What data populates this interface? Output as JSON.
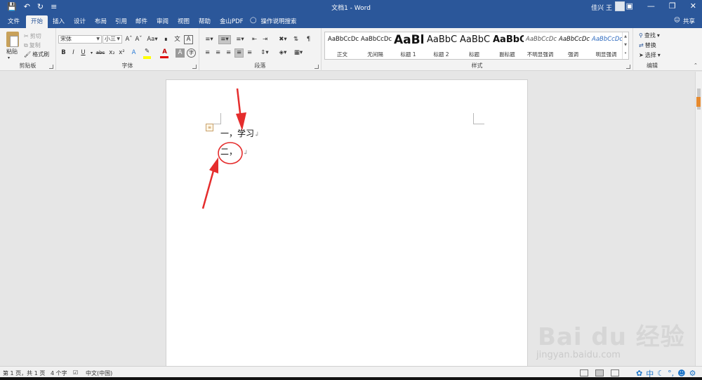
{
  "titlebar": {
    "doc_title": "文档1 - Word",
    "user_name": "佳兴 王"
  },
  "tabs": [
    "文件",
    "开始",
    "插入",
    "设计",
    "布局",
    "引用",
    "邮件",
    "审阅",
    "视图",
    "帮助",
    "金山PDF"
  ],
  "tell_me": "操作说明搜索",
  "share": "共享",
  "clipboard": {
    "paste": "粘贴",
    "cut": "剪切",
    "copy": "复制",
    "format_painter": "格式刷",
    "label": "剪贴板"
  },
  "font": {
    "name": "宋体",
    "size": "小三",
    "label": "字体"
  },
  "paragraph": {
    "label": "段落"
  },
  "styles": {
    "label": "样式",
    "items": [
      {
        "sample": "AaBbCcDc",
        "name": "正文"
      },
      {
        "sample": "AaBbCcDc",
        "name": "无间隔"
      },
      {
        "sample": "AaBl",
        "name": "标题 1"
      },
      {
        "sample": "AaBbC",
        "name": "标题 2"
      },
      {
        "sample": "AaBbC",
        "name": "标题"
      },
      {
        "sample": "AaBbC",
        "name": "副标题"
      },
      {
        "sample": "AaBbCcDc",
        "name": "不明显强调"
      },
      {
        "sample": "AaBbCcDc",
        "name": "强调"
      },
      {
        "sample": "AaBbCcDc",
        "name": "明显强调"
      }
    ]
  },
  "editing": {
    "find": "查找",
    "replace": "替换",
    "select": "选择",
    "label": "编辑"
  },
  "document": {
    "line1": "一，学习",
    "line2": "二，"
  },
  "status": {
    "page": "第 1 页，共 1 页",
    "words": "4 个字",
    "language": "中文(中国)"
  },
  "ime": "中",
  "watermark": {
    "brand": "Bai du 经验",
    "url": "jingyan.baidu.com"
  },
  "colors": {
    "brand": "#2b579a",
    "annotation_red": "#e52d2d"
  }
}
